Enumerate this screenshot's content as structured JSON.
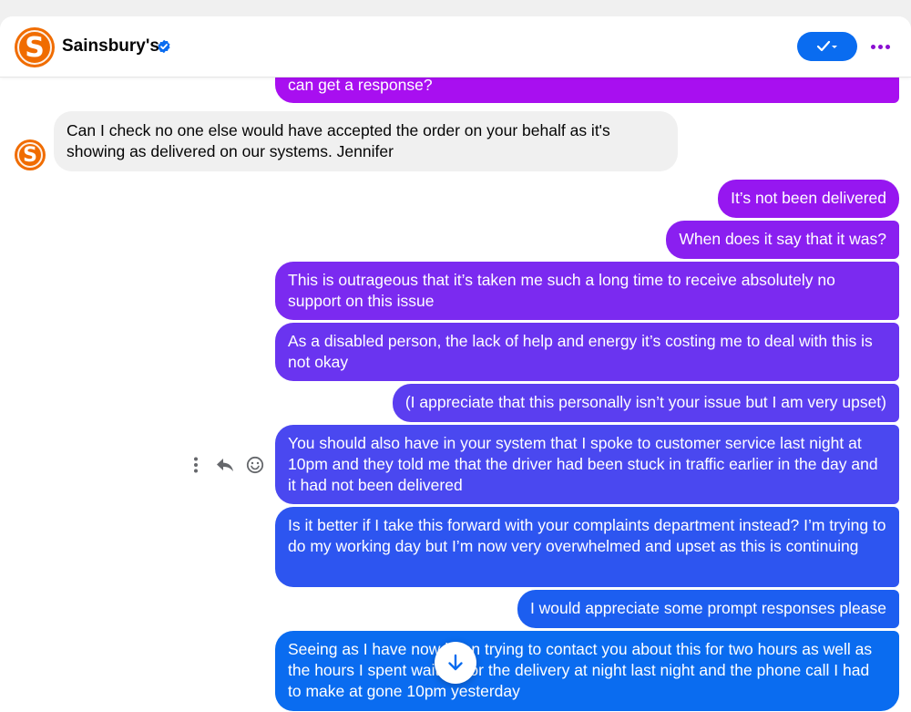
{
  "header": {
    "avatar_letter": "S",
    "title": "Sainsbury's",
    "verified_icon": "verified-badge-icon",
    "read_icon": "check-dropdown-icon",
    "more_icon": "more-dots-icon"
  },
  "messages": [
    {
      "from": "me",
      "text": "can get a response?"
    },
    {
      "from": "them",
      "text": "Can I check no one else would have accepted the order on your behalf as it's showing as delivered on our systems. Jennifer"
    },
    {
      "from": "me",
      "text": "It’s not been delivered"
    },
    {
      "from": "me",
      "text": "When does it say that it was?"
    },
    {
      "from": "me",
      "text": "This is outrageous that it’s taken me such a long time to receive absolutely no support on this issue"
    },
    {
      "from": "me",
      "text": "As a disabled person, the lack of help and energy it’s costing me to deal with this is not okay"
    },
    {
      "from": "me",
      "text": "(I appreciate that this personally isn’t your issue but I am very upset)"
    },
    {
      "from": "me",
      "text": "You should also have in your system that I spoke to customer service last night at 10pm and they told me that the driver had been stuck in traffic earlier in the day and it had not been delivered"
    },
    {
      "from": "me",
      "text": "Is it better if I take this forward with your complaints department instead? I’m trying to do my working day but I’m now very overwhelmed and upset as this is continuing"
    },
    {
      "from": "me",
      "text": "I would appreciate some prompt responses please"
    },
    {
      "from": "me",
      "text": "Seeing as I have now been trying to contact you about this for two hours as well as the hours I spent waiting for the delivery at night last night and the phone call I had to make at gone 10pm yesterday"
    }
  ],
  "message_actions": [
    "more-vertical-icon",
    "reply-icon",
    "emoji-icon"
  ],
  "scroll_icon": "arrow-down-icon",
  "colors": {
    "accent": "#0a6cf0",
    "brand": "#f06c00",
    "gradient_top": "#a80ff0",
    "gradient_bottom": "#0a6cf0"
  }
}
